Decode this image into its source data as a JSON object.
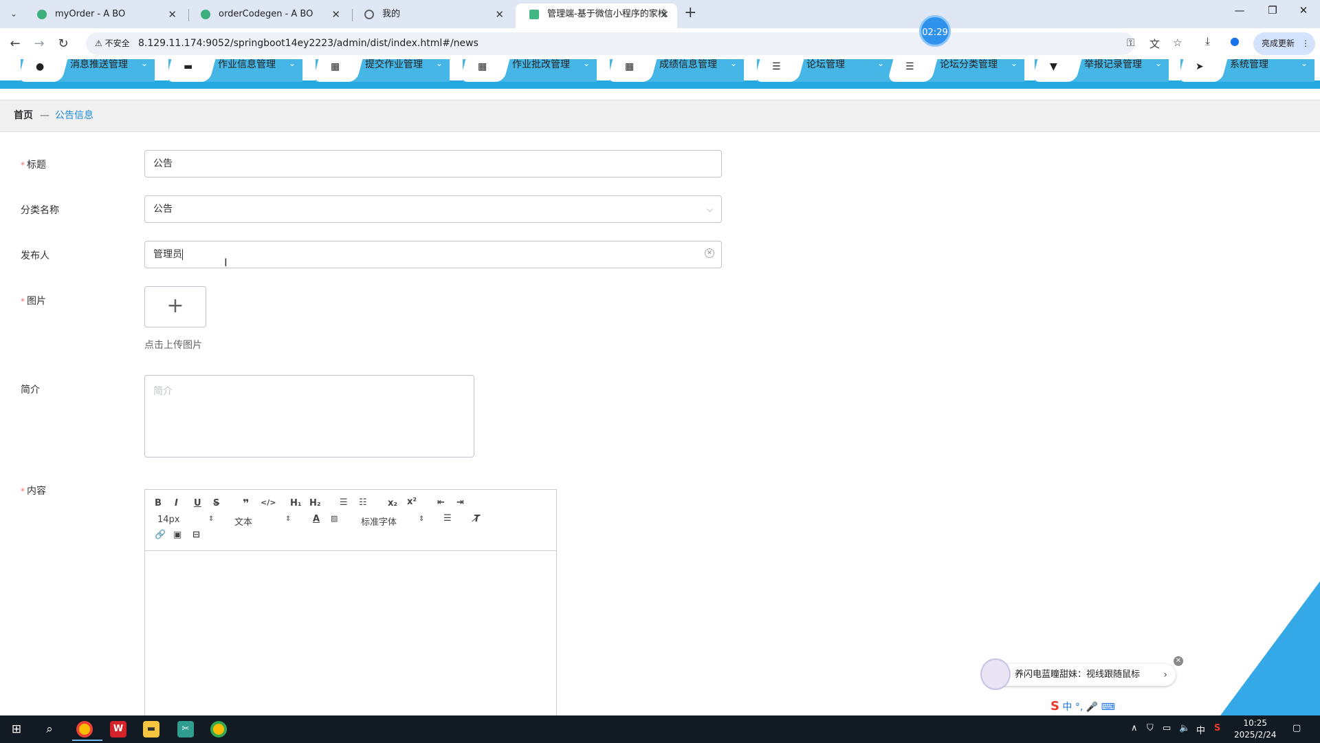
{
  "browser": {
    "tabs": [
      {
        "title": "myOrder - A BO",
        "favicon_color": "#3eaf7c",
        "active": false
      },
      {
        "title": "orderCodegen - A BO",
        "favicon_color": "#3eaf7c",
        "active": false
      },
      {
        "title": "我的",
        "favicon_color": "#5f6368",
        "active": false
      },
      {
        "title": "管理端-基于微信小程序的家校",
        "favicon_color": "#41b883",
        "active": true
      }
    ],
    "new_tab_label": "+",
    "security_label": "不安全",
    "url": "8.129.11.174:9052/springboot14ey2223/admin/dist/index.html#/news",
    "update_button": "亮成更新",
    "timer": "02:29"
  },
  "nav": {
    "items": [
      {
        "label": "消息推送管理",
        "icon": "●"
      },
      {
        "label": "作业信息管理",
        "icon": "▬"
      },
      {
        "label": "提交作业管理",
        "icon": "▦"
      },
      {
        "label": "作业批改管理",
        "icon": "▦"
      },
      {
        "label": "成绩信息管理",
        "icon": "▦"
      },
      {
        "label": "论坛管理",
        "icon": "☰"
      },
      {
        "label": "论坛分类管理",
        "icon": "☰"
      },
      {
        "label": "举报记录管理",
        "icon": "▼"
      },
      {
        "label": "系统管理",
        "icon": "➤"
      }
    ]
  },
  "breadcrumb": {
    "home": "首页",
    "separator": "—",
    "current": "公告信息"
  },
  "form": {
    "title_label": "标题",
    "title_value": "公告",
    "category_label": "分类名称",
    "category_value": "公告",
    "publisher_label": "发布人",
    "publisher_value": "管理员",
    "image_label": "图片",
    "upload_tip": "点击上传图片",
    "intro_label": "简介",
    "intro_placeholder": "简介",
    "content_label": "内容"
  },
  "editor": {
    "font_size": "14px",
    "header_select": "文本",
    "font_family": "标准字体"
  },
  "ime": {
    "popup_text": "养闪电蓝瞳甜妹：视线跟随鼠标",
    "bar_text": "中 °, 🎤 ⌨"
  },
  "taskbar": {
    "time": "10:25",
    "date": "2025/2/24",
    "lang": "中"
  },
  "colors": {
    "nav_bg": "#26a9e0",
    "accent": "#2f93ee",
    "required": "#f56c6c",
    "link": "#1f8cd9"
  }
}
